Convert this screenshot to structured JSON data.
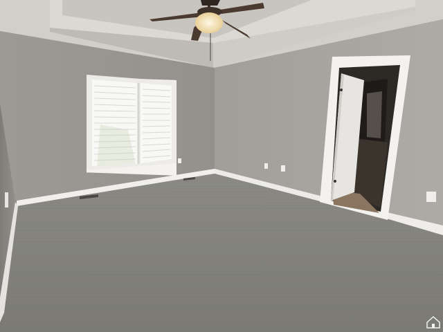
{
  "scene": {
    "colors": {
      "ceiling_tray": "#d9d6d0",
      "ceiling_inner": "#c9c6c1",
      "wall_left": "#8e8b87",
      "wall_back": "#9a9792",
      "wall_right": "#a5a29d",
      "carpet": "#86857f",
      "trim": "#f2f1ee",
      "window_glass": "#f7f7f4",
      "doorway_dark": "#2a2723",
      "door_panel": "#e9e8e4",
      "fan_blade": "#4a3a30",
      "fan_light": "#f6e2b4"
    },
    "icons": {
      "ceiling_fan": "ceiling-fan-icon",
      "watermark": "house-icon"
    }
  }
}
